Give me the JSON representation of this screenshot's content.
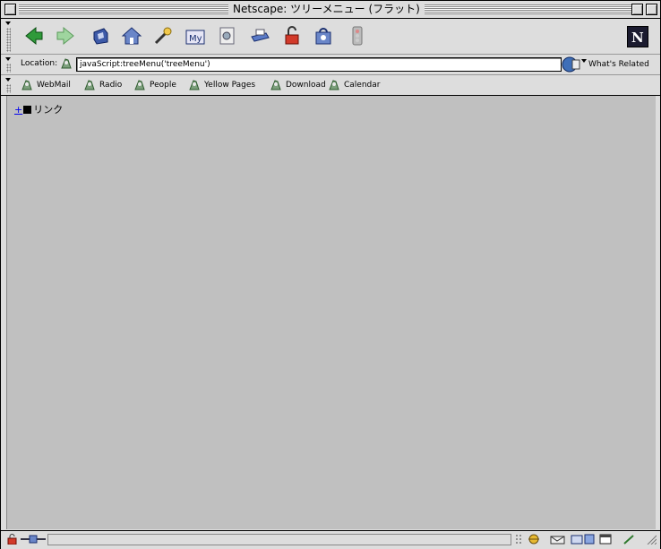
{
  "window": {
    "title": "Netscape: ツリーメニュー (フラット)"
  },
  "nav_toolbar": {
    "buttons": [
      {
        "name": "back",
        "icon": "back-arrow-icon"
      },
      {
        "name": "forward",
        "icon": "forward-arrow-icon"
      },
      {
        "name": "reload",
        "icon": "reload-icon"
      },
      {
        "name": "home",
        "icon": "home-icon"
      },
      {
        "name": "search",
        "icon": "search-icon"
      },
      {
        "name": "my-netscape",
        "icon": "my-netscape-icon",
        "label": "My"
      },
      {
        "name": "images",
        "icon": "images-icon"
      },
      {
        "name": "print",
        "icon": "print-icon"
      },
      {
        "name": "security",
        "icon": "security-lock-icon"
      },
      {
        "name": "shop",
        "icon": "shop-icon"
      },
      {
        "name": "stop",
        "icon": "stop-icon"
      }
    ],
    "logo_letter": "N"
  },
  "location_bar": {
    "label": "Location:",
    "url": "javaScript:treeMenu('treeMenu')",
    "whats_related": "What's Related"
  },
  "personal_toolbar": {
    "items": [
      {
        "label": "WebMail"
      },
      {
        "label": "Radio"
      },
      {
        "label": "People"
      },
      {
        "label": "Yellow Pages"
      },
      {
        "label": "Download"
      },
      {
        "label": "Calendar"
      }
    ]
  },
  "content": {
    "tree": [
      {
        "expander": "+",
        "label": "リンク"
      }
    ]
  },
  "colors": {
    "chrome": "#dddddd",
    "content_bg": "#c0c0c0",
    "link": "#0000ee"
  }
}
